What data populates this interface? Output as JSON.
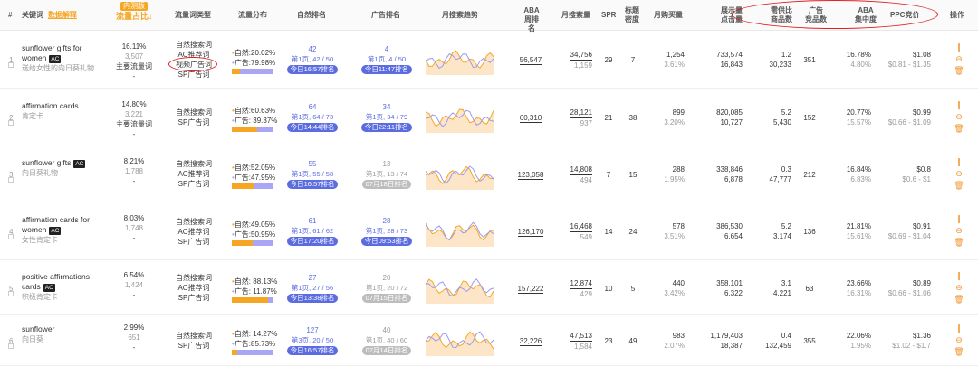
{
  "headers": {
    "idx": "#",
    "keyword": "关键词",
    "keyword_link": "数据解释",
    "traffic_badge": "内测版",
    "traffic_share": "流量占比↓",
    "kw_type": "流量词类型",
    "dist": "流量分布",
    "organic": "自然排名",
    "ad": "广告排名",
    "trend": "月搜索趋势",
    "aba": "ABA\n周排名",
    "monthly": "月搜索量",
    "spr": "SPR",
    "title_density": "标题\n密度",
    "purchases": "月购买量",
    "impressions": "展示量\n点击量",
    "supply_demand": "需供比\n商品数",
    "ad_products": "广告\n竞品数",
    "aba_conc": "ABA\n集中度",
    "ppc": "PPC竞价",
    "ops": "操作"
  },
  "rows": [
    {
      "idx": "1",
      "kw": "sunflower gifts for women",
      "ac": "AC",
      "kw_cn": "送给女性的向日葵礼物",
      "share": "16.11%",
      "share_n": "3,507",
      "share_type": "主要流量词",
      "share_extra": "-",
      "types": [
        "自然搜索词",
        "AC推荐词",
        "视频广告词",
        "SP广告词"
      ],
      "org_pct": "自然:20.02%",
      "ad_pct": "广告:79.98%",
      "org_frac": 0.2,
      "org_rank": "42",
      "org_page": "第1页, 42 / 50",
      "org_time": "今日16:57排名",
      "ad_rank": "4",
      "ad_page": "第1页, 4 / 50",
      "ad_time": "今日11:47排名",
      "ad_gray": false,
      "aba": "56,547",
      "monthly": "34,756",
      "monthly2": "1,159",
      "spr": "29",
      "density": "7",
      "purch": "1,254",
      "purch_pct": "3.61%",
      "imp": "733,574",
      "clk": "16,843",
      "sd": "1.2",
      "sd_n": "30,233",
      "adp": "351",
      "conc": "16.78%",
      "conc2": "4.80%",
      "ppc": "$1.08",
      "ppc_range": "$0.81 - $1.35"
    },
    {
      "idx": "2",
      "kw": "affirmation cards",
      "ac": "",
      "kw_cn": "肯定卡",
      "share": "14.80%",
      "share_n": "3,221",
      "share_type": "主要流量词",
      "share_extra": "-",
      "types": [
        "自然搜索词",
        "SP广告词"
      ],
      "org_pct": "自然:60.63%",
      "ad_pct": "广告: 39.37%",
      "org_frac": 0.606,
      "org_rank": "64",
      "org_page": "第1页, 64 / 73",
      "org_time": "今日14:44排名",
      "ad_rank": "34",
      "ad_page": "第1页, 34 / 79",
      "ad_time": "今日22:11排名",
      "ad_gray": false,
      "aba": "60,310",
      "monthly": "28,121",
      "monthly2": "937",
      "spr": "21",
      "density": "38",
      "purch": "899",
      "purch_pct": "3.20%",
      "imp": "820,085",
      "clk": "10,727",
      "sd": "5.2",
      "sd_n": "5,430",
      "adp": "152",
      "conc": "20.77%",
      "conc2": "15.57%",
      "ppc": "$0.99",
      "ppc_range": "$0.66 - $1.09"
    },
    {
      "idx": "3",
      "kw": "sunflower gifts",
      "ac": "AC",
      "kw_cn": "向日葵礼物",
      "share": "8.21%",
      "share_n": "1,788",
      "share_type": "-",
      "share_extra": "",
      "types": [
        "自然搜索词",
        "AC推荐词",
        "SP广告词"
      ],
      "org_pct": "自然:52.05%",
      "ad_pct": "广告:47.95%",
      "org_frac": 0.52,
      "org_rank": "55",
      "org_page": "第1页, 55 / 58",
      "org_time": "今日16:57排名",
      "ad_rank": "13",
      "ad_page": "第1页, 13 / 74",
      "ad_time": "07月18日排名",
      "ad_gray": true,
      "aba": "123,058",
      "monthly": "14,808",
      "monthly2": "494",
      "spr": "7",
      "density": "15",
      "purch": "288",
      "purch_pct": "1.95%",
      "imp": "338,846",
      "clk": "6,878",
      "sd": "0.3",
      "sd_n": "47,777",
      "adp": "212",
      "conc": "16.84%",
      "conc2": "6.83%",
      "ppc": "$0.8",
      "ppc_range": "$0.6 - $1"
    },
    {
      "idx": "4",
      "kw": "affirmation cards for women",
      "ac": "AC",
      "kw_cn": "女性肯定卡",
      "share": "8.03%",
      "share_n": "1,748",
      "share_type": "-",
      "share_extra": "",
      "types": [
        "自然搜索词",
        "AC推荐词",
        "SP广告词"
      ],
      "org_pct": "自然:49.05%",
      "ad_pct": "广告:50.95%",
      "org_frac": 0.49,
      "org_rank": "61",
      "org_page": "第1页, 61 / 62",
      "org_time": "今日17:20排名",
      "ad_rank": "28",
      "ad_page": "第1页, 28 / 73",
      "ad_time": "今日09:53排名",
      "ad_gray": false,
      "aba": "126,170",
      "monthly": "16,468",
      "monthly2": "549",
      "spr": "14",
      "density": "24",
      "purch": "578",
      "purch_pct": "3.51%",
      "imp": "386,530",
      "clk": "6,654",
      "sd": "5.2",
      "sd_n": "3,174",
      "adp": "136",
      "conc": "21.81%",
      "conc2": "15.61%",
      "ppc": "$0.91",
      "ppc_range": "$0.69 - $1.04"
    },
    {
      "idx": "5",
      "kw": "positive affirmations cards",
      "ac": "AC",
      "kw_cn": "积极肯定卡",
      "share": "6.54%",
      "share_n": "1,424",
      "share_type": "-",
      "share_extra": "",
      "types": [
        "自然搜索词",
        "AC推荐词",
        "SP广告词"
      ],
      "org_pct": "自然: 88.13%",
      "ad_pct": "广告: 11.87%",
      "org_frac": 0.88,
      "org_rank": "27",
      "org_page": "第1页, 27 / 56",
      "org_time": "今日13:38排名",
      "ad_rank": "20",
      "ad_page": "第1页, 20 / 72",
      "ad_time": "07月15日排名",
      "ad_gray": true,
      "aba": "157,222",
      "monthly": "12,874",
      "monthly2": "429",
      "spr": "10",
      "density": "5",
      "purch": "440",
      "purch_pct": "3.42%",
      "imp": "358,101",
      "clk": "6,322",
      "sd": "3.1",
      "sd_n": "4,221",
      "adp": "63",
      "conc": "23.66%",
      "conc2": "16.31%",
      "ppc": "$0.89",
      "ppc_range": "$0.66 - $1.06"
    },
    {
      "idx": "6",
      "kw": "sunflower",
      "ac": "",
      "kw_cn": "向日葵",
      "share": "2.99%",
      "share_n": "651",
      "share_type": "-",
      "share_extra": "",
      "types": [
        "自然搜索词",
        "SP广告词"
      ],
      "org_pct": "自然: 14.27%",
      "ad_pct": "广告:85.73%",
      "org_frac": 0.14,
      "org_rank": "127",
      "org_page": "第3页, 20 / 50",
      "org_time": "今日16:57排名",
      "ad_rank": "40",
      "ad_page": "第1页, 40 / 60",
      "ad_time": "07月14日排名",
      "ad_gray": true,
      "aba": "32,226",
      "monthly": "47,513",
      "monthly2": "1,584",
      "spr": "23",
      "density": "49",
      "purch": "983",
      "purch_pct": "2.07%",
      "imp": "1,179,403",
      "clk": "18,387",
      "sd": "0.4",
      "sd_n": "132,459",
      "adp": "355",
      "conc": "22.06%",
      "conc2": "1.95%",
      "ppc": "$1.36",
      "ppc_range": "$1.02 - $1.7"
    }
  ],
  "colors": {
    "accent": "#5b6be0",
    "orange": "#f5a623",
    "purple": "#a9a7f5",
    "red": "#e02020"
  },
  "icons": [
    "chart-icon",
    "minus-circle-icon",
    "trash-icon"
  ]
}
